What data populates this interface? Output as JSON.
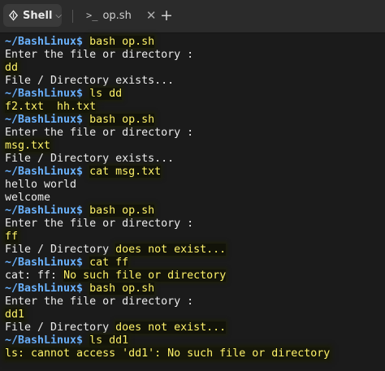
{
  "tabs": {
    "shell_label": "Shell",
    "op_label": "op.sh",
    "op_glyph": ">_",
    "close_glyph": "✕",
    "new_tab_glyph": "+"
  },
  "terminal": {
    "prompt": "~/BashLinux$",
    "lines": [
      {
        "cmd": "bash op.sh"
      },
      {
        "out": "Enter the file or directory :"
      },
      {
        "input": "dd"
      },
      {
        "out": "File / Directory exists..."
      },
      {
        "cmd": "ls dd"
      },
      {
        "output_hl": "f2.txt  hh.txt"
      },
      {
        "cmd": "bash op.sh"
      },
      {
        "out": "Enter the file or directory :"
      },
      {
        "input": "msg.txt"
      },
      {
        "out": "File / Directory exists..."
      },
      {
        "cmd": "cat msg.txt"
      },
      {
        "out": "hello world"
      },
      {
        "out": "welcome"
      },
      {
        "cmd": "bash op.sh"
      },
      {
        "out": "Enter the file or directory :"
      },
      {
        "input": "ff"
      },
      {
        "out": "File / Directory ",
        "hl": "does not exist..."
      },
      {
        "cmd": "cat ff"
      },
      {
        "out": "cat: ff: ",
        "hl": "No such file or directory"
      },
      {
        "cmd": "bash op.sh"
      },
      {
        "out": "Enter the file or directory :"
      },
      {
        "input": "dd1"
      },
      {
        "out": "File / Directory ",
        "hl": "does not exist..."
      },
      {
        "cmd": "ls dd1"
      },
      {
        "output_hl": "ls: cannot access 'dd1': No such file or directory"
      }
    ]
  }
}
